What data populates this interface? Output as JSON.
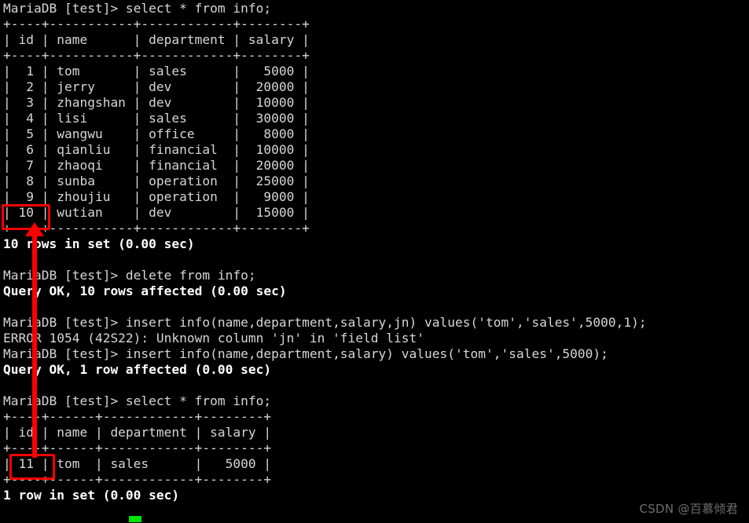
{
  "terminal": {
    "background_color": "#000000",
    "text_color": "#d6d6d6",
    "bold_color": "#ffffff",
    "prompt": "MariaDB [test]>",
    "lines": [
      {
        "text": "MariaDB [test]> select * from info;",
        "bold": false
      },
      {
        "text": "+----+-----------+------------+--------+",
        "bold": false
      },
      {
        "text": "| id | name      | department | salary |",
        "bold": false
      },
      {
        "text": "+----+-----------+------------+--------+",
        "bold": false
      },
      {
        "text": "|  1 | tom       | sales      |   5000 |",
        "bold": false
      },
      {
        "text": "|  2 | jerry     | dev        |  20000 |",
        "bold": false
      },
      {
        "text": "|  3 | zhangshan | dev        |  10000 |",
        "bold": false
      },
      {
        "text": "|  4 | lisi      | sales      |  30000 |",
        "bold": false
      },
      {
        "text": "|  5 | wangwu    | office     |   8000 |",
        "bold": false
      },
      {
        "text": "|  6 | qianliu   | financial  |  10000 |",
        "bold": false
      },
      {
        "text": "|  7 | zhaoqi    | financial  |  20000 |",
        "bold": false
      },
      {
        "text": "|  8 | sunba     | operation  |  25000 |",
        "bold": false
      },
      {
        "text": "|  9 | zhoujiu   | operation  |   9000 |",
        "bold": false
      },
      {
        "text": "| 10 | wutian    | dev        |  15000 |",
        "bold": false
      },
      {
        "text": "+----+-----------+------------+--------+",
        "bold": false
      },
      {
        "text": "10 rows in set (0.00 sec)",
        "bold": true
      },
      {
        "text": "",
        "bold": false
      },
      {
        "text": "MariaDB [test]> delete from info;",
        "bold": false
      },
      {
        "text": "Query OK, 10 rows affected (0.00 sec)",
        "bold": true
      },
      {
        "text": "",
        "bold": false
      },
      {
        "text": "MariaDB [test]> insert info(name,department,salary,jn) values('tom','sales',5000,1);",
        "bold": false
      },
      {
        "text": "ERROR 1054 (42S22): Unknown column 'jn' in 'field list'",
        "bold": false
      },
      {
        "text": "MariaDB [test]> insert info(name,department,salary) values('tom','sales',5000);",
        "bold": false
      },
      {
        "text": "Query OK, 1 row affected (0.00 sec)",
        "bold": true
      },
      {
        "text": "",
        "bold": false
      },
      {
        "text": "MariaDB [test]> select * from info;",
        "bold": false
      },
      {
        "text": "+----+------+------------+--------+",
        "bold": false
      },
      {
        "text": "| id | name | department | salary |",
        "bold": false
      },
      {
        "text": "+----+------+------------+--------+",
        "bold": false
      },
      {
        "text": "| 11 | tom  | sales      |   5000 |",
        "bold": false
      },
      {
        "text": "+----+------+------------+--------+",
        "bold": false
      },
      {
        "text": "1 row in set (0.00 sec)",
        "bold": true
      },
      {
        "text": "",
        "bold": false
      }
    ]
  },
  "queries": {
    "select_all": "select * from info;",
    "delete_all": "delete from info;",
    "insert_bad_column": "insert info(name,department,salary,jn) values('tom','sales',5000,1);",
    "insert_good": "insert info(name,department,salary) values('tom','sales',5000);"
  },
  "results": {
    "first_select": {
      "columns": [
        "id",
        "name",
        "department",
        "salary"
      ],
      "rows": [
        [
          "1",
          "tom",
          "sales",
          "5000"
        ],
        [
          "2",
          "jerry",
          "dev",
          "20000"
        ],
        [
          "3",
          "zhangshan",
          "dev",
          "10000"
        ],
        [
          "4",
          "lisi",
          "sales",
          "30000"
        ],
        [
          "5",
          "wangwu",
          "office",
          "8000"
        ],
        [
          "6",
          "qianliu",
          "financial",
          "10000"
        ],
        [
          "7",
          "zhaoqi",
          "financial",
          "20000"
        ],
        [
          "8",
          "sunba",
          "operation",
          "25000"
        ],
        [
          "9",
          "zhoujiu",
          "operation",
          "9000"
        ],
        [
          "10",
          "wutian",
          "dev",
          "15000"
        ]
      ],
      "footer": "10 rows in set (0.00 sec)"
    },
    "delete_status": "Query OK, 10 rows affected (0.00 sec)",
    "insert_error": "ERROR 1054 (42S22): Unknown column 'jn' in 'field list'",
    "insert_status": "Query OK, 1 row affected (0.00 sec)",
    "second_select": {
      "columns": [
        "id",
        "name",
        "department",
        "salary"
      ],
      "rows": [
        [
          "11",
          "tom",
          "sales",
          "5000"
        ]
      ],
      "footer": "1 row in set (0.00 sec)"
    }
  },
  "annotations": {
    "highlight_color": "#fe0000",
    "box_top_value": "10",
    "box_bottom_value": "11",
    "arrow_direction": "up"
  },
  "cursor": {
    "color": "#00e500",
    "visible": true
  },
  "watermark": {
    "text": "CSDN @百慕倾君",
    "color": "#6e6e6e"
  }
}
